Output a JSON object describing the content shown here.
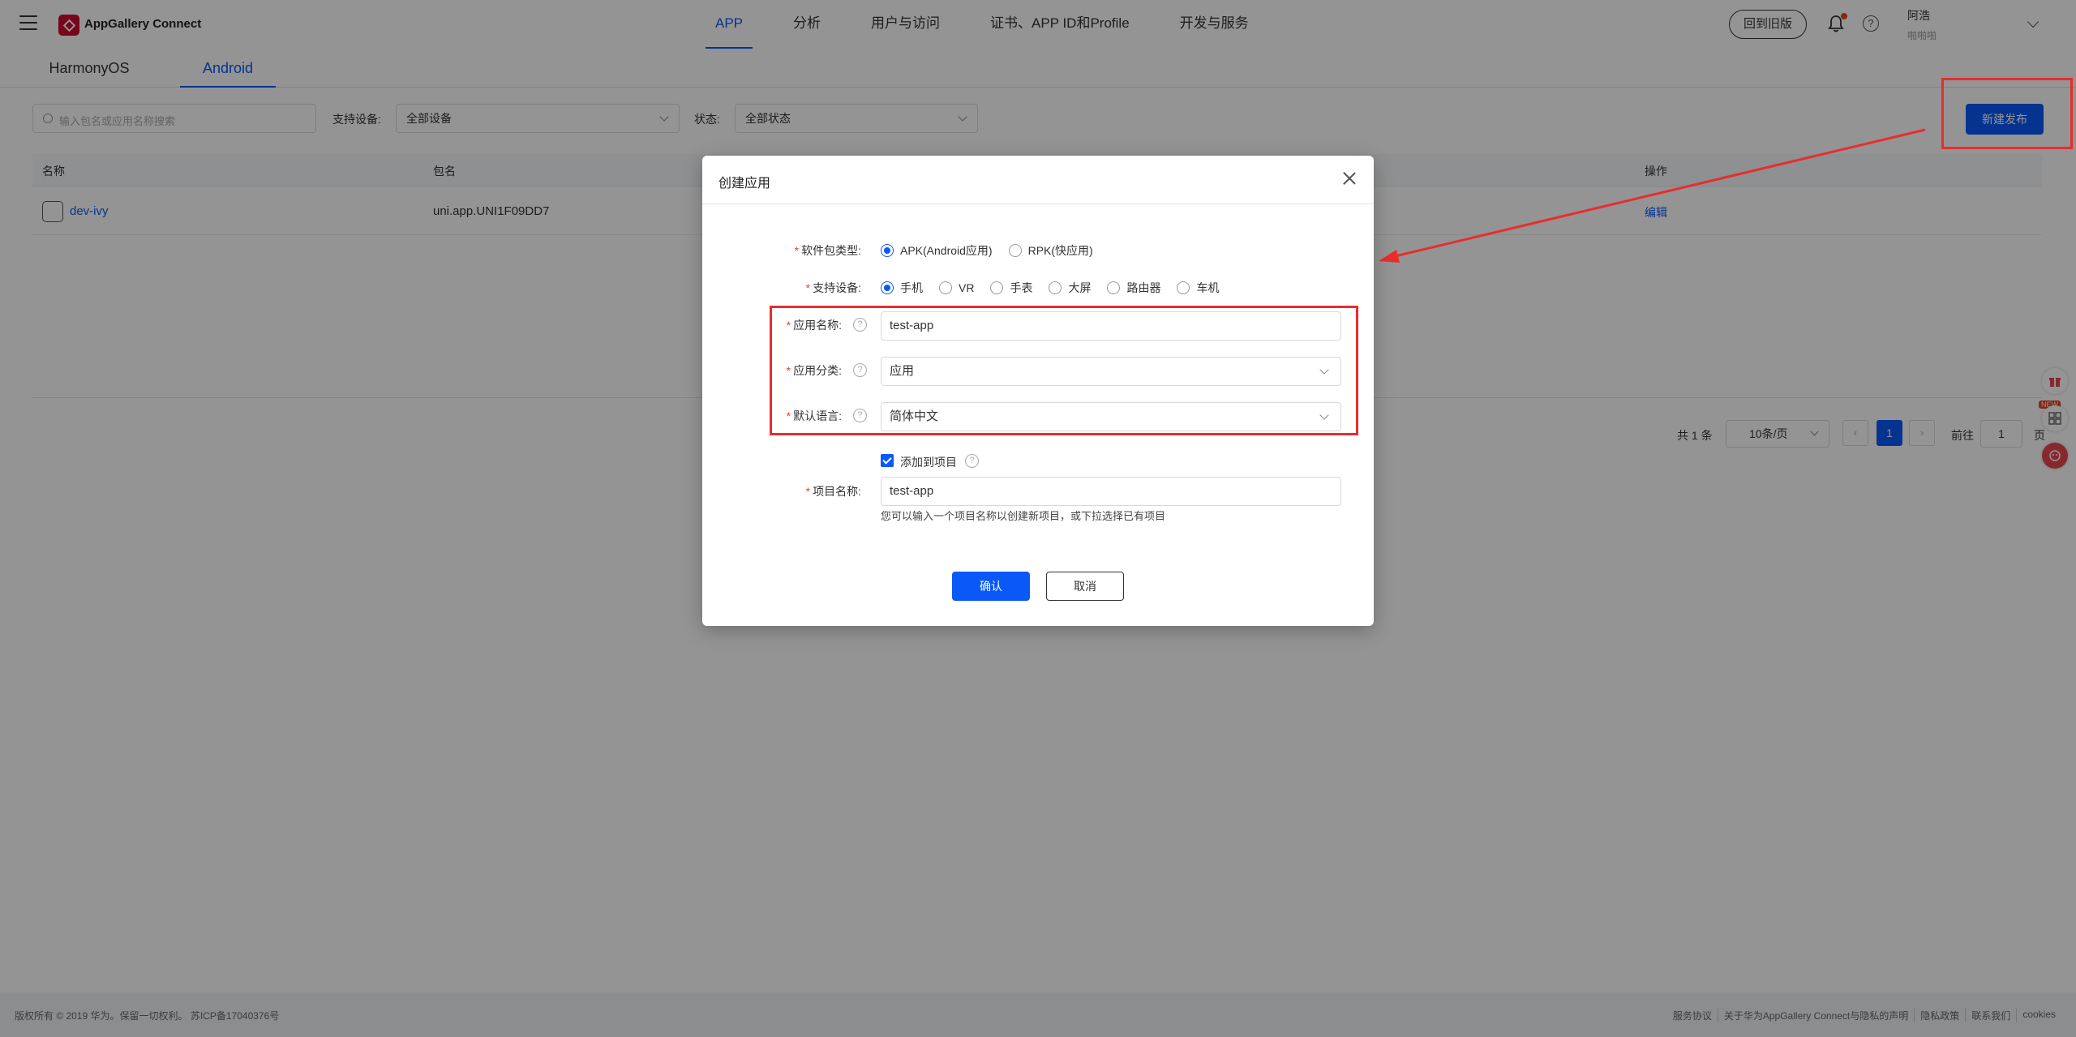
{
  "header": {
    "brand": "AppGallery Connect",
    "nav": [
      "APP",
      "分析",
      "用户与访问",
      "证书、APP ID和Profile",
      "开发与服务"
    ],
    "active_nav": "APP",
    "back_old": "回到旧版",
    "user_name": "阿浩",
    "user_sub": "啪啪啪"
  },
  "subtabs": [
    "HarmonyOS",
    "Android"
  ],
  "filters": {
    "search_placeholder": "输入包名或应用名称搜索",
    "device_label": "支持设备:",
    "device_value": "全部设备",
    "status_label": "状态:",
    "status_value": "全部状态",
    "new_release": "新建发布"
  },
  "table": {
    "headers": [
      "名称",
      "包名",
      "操作"
    ],
    "rows": [
      {
        "name": "dev-ivy",
        "package": "uni.app.UNI1F09DD7",
        "action": "编辑"
      }
    ]
  },
  "pagination": {
    "total": "共 1 条",
    "page_size": "10条/页",
    "prev": "‹",
    "current": "1",
    "next": "›",
    "goto": "前往",
    "goto_value": "1",
    "page_suffix": "页"
  },
  "float_widgets": {
    "new_tag": "NEW"
  },
  "footer": {
    "copyright": "版权所有 © 2019 华为。保留一切权利。 苏ICP备17040376号",
    "links": [
      "服务协议",
      "关于华为AppGallery Connect与隐私的声明",
      "隐私政策",
      "联系我们",
      "cookies"
    ]
  },
  "dialog": {
    "title": "创建应用",
    "package_type_label": "软件包类型:",
    "package_types": [
      "APK(Android应用)",
      "RPK(快应用)"
    ],
    "package_type_selected": 0,
    "device_label": "支持设备:",
    "devices": [
      "手机",
      "VR",
      "手表",
      "大屏",
      "路由器",
      "车机"
    ],
    "device_selected": 0,
    "app_name_label": "应用名称:",
    "app_name_value": "test-app",
    "category_label": "应用分类:",
    "category_value": "应用",
    "language_label": "默认语言:",
    "language_value": "简体中文",
    "add_to_project_label": "添加到项目",
    "project_name_label": "项目名称:",
    "project_name_value": "test-app",
    "project_hint": "您可以输入一个项目名称以创建新项目，或下拉选择已有项目",
    "confirm": "确认",
    "cancel": "取消"
  },
  "colors": {
    "accent": "#0a59f7",
    "annotation_red": "#e82d2d",
    "brand_red": "#cf0a2c"
  }
}
